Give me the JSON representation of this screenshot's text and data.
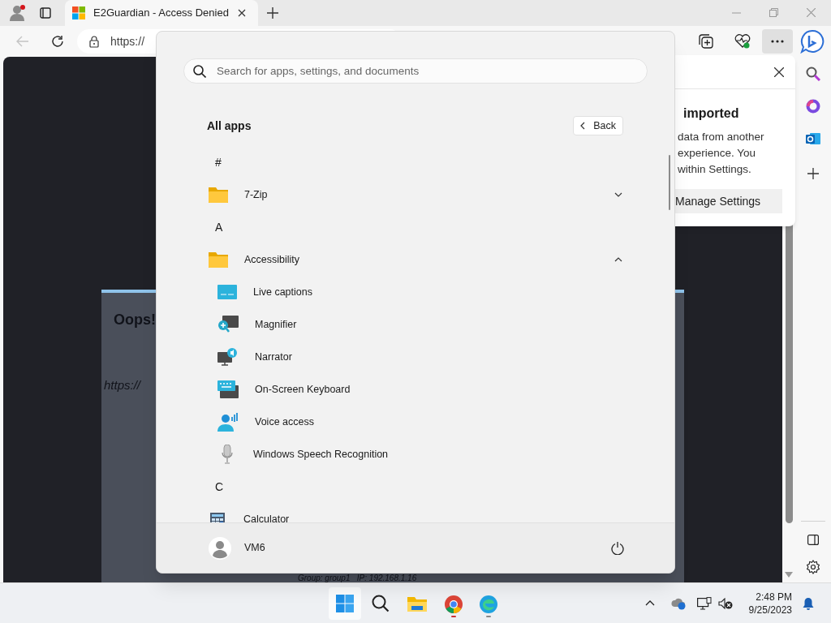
{
  "browser": {
    "tab": {
      "title": "E2Guardian - Access Denied"
    },
    "address": "https://"
  },
  "page": {
    "heading": "Oops!",
    "url": "https://",
    "footer": "Group: group1   IP: 192.168.1.16"
  },
  "popup": {
    "title": "imported",
    "lines": [
      "data from another",
      "experience. You",
      "within Settings."
    ],
    "button": "Manage Settings"
  },
  "start_menu": {
    "search": {
      "placeholder": "Search for apps, settings, and documents"
    },
    "heading": "All apps",
    "back": "Back",
    "sections": [
      {
        "letter": "#",
        "apps": [
          {
            "name": "7-Zip",
            "kind": "folder",
            "expanded": false
          }
        ]
      },
      {
        "letter": "A",
        "apps": [
          {
            "name": "Accessibility",
            "kind": "folder",
            "expanded": true,
            "children": [
              {
                "name": "Live captions",
                "kind": "captions"
              },
              {
                "name": "Magnifier",
                "kind": "magnifier"
              },
              {
                "name": "Narrator",
                "kind": "narrator"
              },
              {
                "name": "On-Screen Keyboard",
                "kind": "keyboard"
              },
              {
                "name": "Voice access",
                "kind": "voice"
              },
              {
                "name": "Windows Speech Recognition",
                "kind": "microphone"
              }
            ]
          }
        ]
      },
      {
        "letter": "C",
        "apps": [
          {
            "name": "Calculator",
            "kind": "calculator"
          }
        ]
      }
    ],
    "user": "VM6"
  },
  "taskbar": {
    "time": "2:48 PM",
    "date": "9/25/2023"
  }
}
